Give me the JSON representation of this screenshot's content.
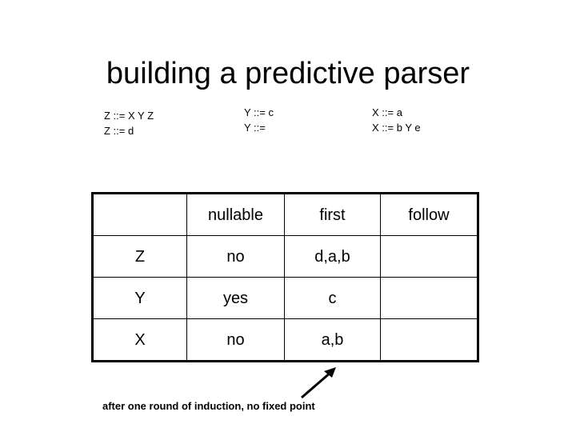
{
  "slide": {
    "title": "building a predictive parser",
    "background_color": "#ffffff",
    "text_color": "#000000"
  },
  "grammar": {
    "groups": [
      {
        "rules": [
          "Z ::= X Y Z",
          "Z ::= d"
        ]
      },
      {
        "rules": [
          "Y ::= c",
          "Y ::="
        ]
      },
      {
        "rules": [
          "X ::= a",
          "X ::= b Y e"
        ]
      }
    ]
  },
  "table": {
    "headers": [
      "",
      "nullable",
      "first",
      "follow"
    ],
    "rows": [
      {
        "symbol": "Z",
        "nullable": "no",
        "first": "d,a,b",
        "follow": ""
      },
      {
        "symbol": "Y",
        "nullable": "yes",
        "first": "c",
        "follow": ""
      },
      {
        "symbol": "X",
        "nullable": "no",
        "first": "a,b",
        "follow": ""
      }
    ]
  },
  "caption": {
    "text": "after one round of induction, no fixed point",
    "arrow": "arrow-up-right-icon"
  },
  "chart_data": {
    "type": "table",
    "title": "building a predictive parser",
    "columns": [
      "",
      "nullable",
      "first",
      "follow"
    ],
    "rows": [
      [
        "Z",
        "no",
        "d,a,b",
        ""
      ],
      [
        "Y",
        "yes",
        "c",
        ""
      ],
      [
        "X",
        "no",
        "a,b",
        ""
      ]
    ],
    "annotations": [
      "after one round of induction, no fixed point"
    ]
  }
}
